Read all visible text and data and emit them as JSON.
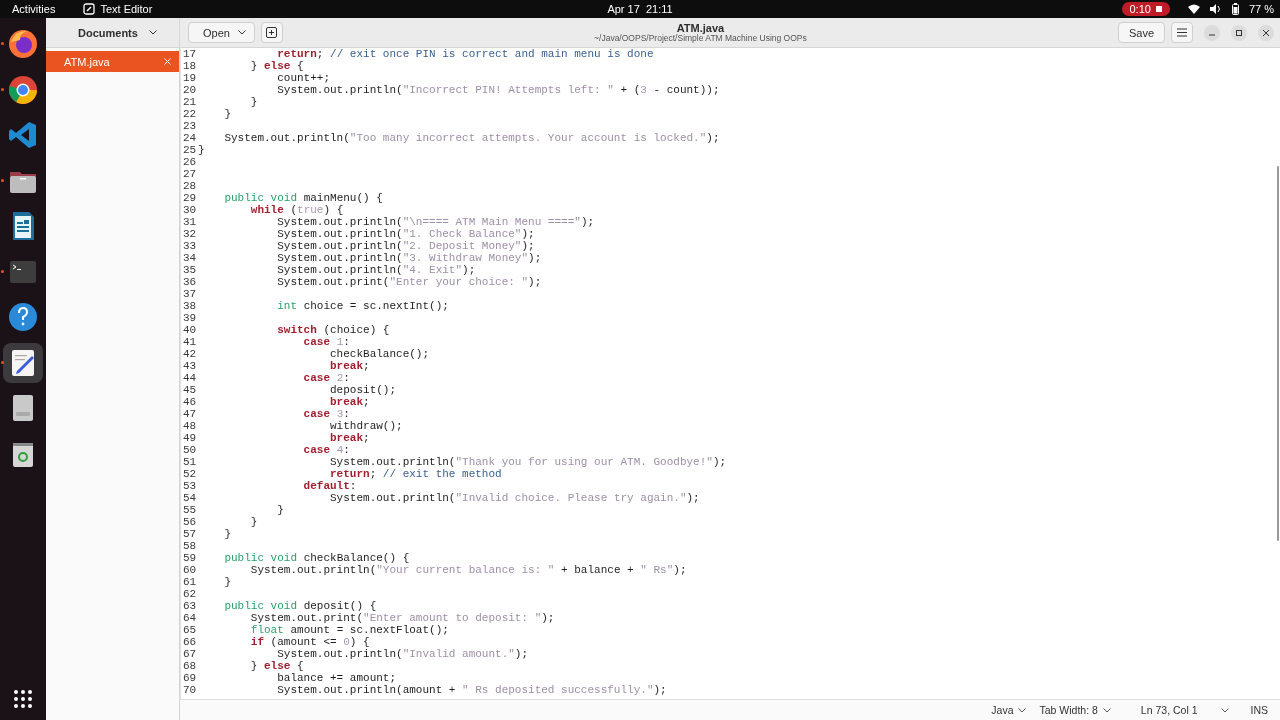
{
  "top_bar": {
    "activities": "Activities",
    "app_name": "Text Editor",
    "clock": "Apr 17  21:11",
    "recording_time": "0:10",
    "battery": "77 %"
  },
  "dock": [
    {
      "kind": "firefox",
      "running": true,
      "selected": false
    },
    {
      "kind": "chrome",
      "running": true,
      "selected": false
    },
    {
      "kind": "vscode",
      "running": false,
      "selected": false
    },
    {
      "kind": "files",
      "running": true,
      "selected": false
    },
    {
      "kind": "writer",
      "running": false,
      "selected": false
    },
    {
      "kind": "terminal",
      "running": true,
      "selected": false
    },
    {
      "kind": "help",
      "running": false,
      "selected": false
    },
    {
      "kind": "editor",
      "running": true,
      "selected": true
    },
    {
      "kind": "drive",
      "running": false,
      "selected": false
    },
    {
      "kind": "trash",
      "running": false,
      "selected": false
    }
  ],
  "header": {
    "sidebar_title": "Documents",
    "open_button": "Open",
    "title": "ATM.java",
    "subtitle": "~/Java/OOPS/Project/Simple ATM Machine Using OOPs",
    "save_button": "Save"
  },
  "documents": [
    {
      "name": "ATM.java",
      "selected": true
    }
  ],
  "code": [
    {
      "number": "17",
      "tokens": [
        {
          "kind": "keyword",
          "text": "            return"
        },
        {
          "kind": "plain",
          "text": "; "
        },
        {
          "kind": "comment",
          "text": "// exit once PIN is correct and main menu is done"
        }
      ]
    },
    {
      "number": "18",
      "tokens": [
        {
          "kind": "plain",
          "text": "        } "
        },
        {
          "kind": "keyword",
          "text": "else"
        },
        {
          "kind": "plain",
          "text": " {"
        }
      ]
    },
    {
      "number": "19",
      "tokens": [
        {
          "kind": "plain",
          "text": "            count++;"
        }
      ]
    },
    {
      "number": "20",
      "tokens": [
        {
          "kind": "plain",
          "text": "            System.out.println("
        },
        {
          "kind": "string",
          "text": "\"Incorrect PIN! Attempts left: \""
        },
        {
          "kind": "plain",
          "text": " + ("
        },
        {
          "kind": "number",
          "text": "3"
        },
        {
          "kind": "plain",
          "text": " - count));"
        }
      ]
    },
    {
      "number": "21",
      "tokens": [
        {
          "kind": "plain",
          "text": "        }"
        }
      ]
    },
    {
      "number": "22",
      "tokens": [
        {
          "kind": "plain",
          "text": "    }"
        }
      ]
    },
    {
      "number": "23"
    },
    {
      "number": "24",
      "tokens": [
        {
          "kind": "plain",
          "text": "    System.out.println("
        },
        {
          "kind": "string",
          "text": "\"Too many incorrect attempts. Your account is locked.\""
        },
        {
          "kind": "plain",
          "text": ");"
        }
      ]
    },
    {
      "number": "25",
      "tokens": [
        {
          "kind": "plain",
          "text": "}"
        }
      ]
    },
    {
      "number": "26"
    },
    {
      "number": "27"
    },
    {
      "number": "28"
    },
    {
      "number": "29",
      "tokens": [
        {
          "kind": "type",
          "text": "    public"
        },
        {
          "kind": "type",
          "text": " void"
        },
        {
          "kind": "plain",
          "text": " mainMenu() {"
        }
      ]
    },
    {
      "number": "30",
      "tokens": [
        {
          "kind": "keyword",
          "text": "        while"
        },
        {
          "kind": "plain",
          "text": " ("
        },
        {
          "kind": "number",
          "text": "true"
        },
        {
          "kind": "plain",
          "text": ") {"
        }
      ]
    },
    {
      "number": "31",
      "tokens": [
        {
          "kind": "plain",
          "text": "            System.out.println("
        },
        {
          "kind": "string",
          "text": "\"\\n==== ATM Main Menu ====\""
        },
        {
          "kind": "plain",
          "text": ");"
        }
      ]
    },
    {
      "number": "32",
      "tokens": [
        {
          "kind": "plain",
          "text": "            System.out.println("
        },
        {
          "kind": "string",
          "text": "\"1. Check Balance\""
        },
        {
          "kind": "plain",
          "text": ");"
        }
      ]
    },
    {
      "number": "33",
      "tokens": [
        {
          "kind": "plain",
          "text": "            System.out.println("
        },
        {
          "kind": "string",
          "text": "\"2. Deposit Money\""
        },
        {
          "kind": "plain",
          "text": ");"
        }
      ]
    },
    {
      "number": "34",
      "tokens": [
        {
          "kind": "plain",
          "text": "            System.out.println("
        },
        {
          "kind": "string",
          "text": "\"3. Withdraw Money\""
        },
        {
          "kind": "plain",
          "text": ");"
        }
      ]
    },
    {
      "number": "35",
      "tokens": [
        {
          "kind": "plain",
          "text": "            System.out.println("
        },
        {
          "kind": "string",
          "text": "\"4. Exit\""
        },
        {
          "kind": "plain",
          "text": ");"
        }
      ]
    },
    {
      "number": "36",
      "tokens": [
        {
          "kind": "plain",
          "text": "            System.out.print("
        },
        {
          "kind": "string",
          "text": "\"Enter your choice: \""
        },
        {
          "kind": "plain",
          "text": ");"
        }
      ]
    },
    {
      "number": "37"
    },
    {
      "number": "38",
      "tokens": [
        {
          "kind": "type",
          "text": "            int"
        },
        {
          "kind": "plain",
          "text": " choice = sc.nextInt();"
        }
      ]
    },
    {
      "number": "39"
    },
    {
      "number": "40",
      "tokens": [
        {
          "kind": "keyword",
          "text": "            switch"
        },
        {
          "kind": "plain",
          "text": " (choice) {"
        }
      ]
    },
    {
      "number": "41",
      "tokens": [
        {
          "kind": "keyword",
          "text": "                case"
        },
        {
          "kind": "number",
          "text": " 1"
        },
        {
          "kind": "plain",
          "text": ":"
        }
      ]
    },
    {
      "number": "42",
      "tokens": [
        {
          "kind": "plain",
          "text": "                    checkBalance();"
        }
      ]
    },
    {
      "number": "43",
      "tokens": [
        {
          "kind": "keyword",
          "text": "                    break"
        },
        {
          "kind": "plain",
          "text": ";"
        }
      ]
    },
    {
      "number": "44",
      "tokens": [
        {
          "kind": "keyword",
          "text": "                case"
        },
        {
          "kind": "number",
          "text": " 2"
        },
        {
          "kind": "plain",
          "text": ":"
        }
      ]
    },
    {
      "number": "45",
      "tokens": [
        {
          "kind": "plain",
          "text": "                    deposit();"
        }
      ]
    },
    {
      "number": "46",
      "tokens": [
        {
          "kind": "keyword",
          "text": "                    break"
        },
        {
          "kind": "plain",
          "text": ";"
        }
      ]
    },
    {
      "number": "47",
      "tokens": [
        {
          "kind": "keyword",
          "text": "                case"
        },
        {
          "kind": "number",
          "text": " 3"
        },
        {
          "kind": "plain",
          "text": ":"
        }
      ]
    },
    {
      "number": "48",
      "tokens": [
        {
          "kind": "plain",
          "text": "                    withdraw();"
        }
      ]
    },
    {
      "number": "49",
      "tokens": [
        {
          "kind": "keyword",
          "text": "                    break"
        },
        {
          "kind": "plain",
          "text": ";"
        }
      ]
    },
    {
      "number": "50",
      "tokens": [
        {
          "kind": "keyword",
          "text": "                case"
        },
        {
          "kind": "number",
          "text": " 4"
        },
        {
          "kind": "plain",
          "text": ":"
        }
      ]
    },
    {
      "number": "51",
      "tokens": [
        {
          "kind": "plain",
          "text": "                    System.out.println("
        },
        {
          "kind": "string",
          "text": "\"Thank you for using our ATM. Goodbye!\""
        },
        {
          "kind": "plain",
          "text": ");"
        }
      ]
    },
    {
      "number": "52",
      "tokens": [
        {
          "kind": "keyword",
          "text": "                    return"
        },
        {
          "kind": "plain",
          "text": "; "
        },
        {
          "kind": "comment",
          "text": "// exit the method"
        }
      ]
    },
    {
      "number": "53",
      "tokens": [
        {
          "kind": "keyword",
          "text": "                default"
        },
        {
          "kind": "plain",
          "text": ":"
        }
      ]
    },
    {
      "number": "54",
      "tokens": [
        {
          "kind": "plain",
          "text": "                    System.out.println("
        },
        {
          "kind": "string",
          "text": "\"Invalid choice. Please try again.\""
        },
        {
          "kind": "plain",
          "text": ");"
        }
      ]
    },
    {
      "number": "55",
      "tokens": [
        {
          "kind": "plain",
          "text": "            }"
        }
      ]
    },
    {
      "number": "56",
      "tokens": [
        {
          "kind": "plain",
          "text": "        }"
        }
      ]
    },
    {
      "number": "57",
      "tokens": [
        {
          "kind": "plain",
          "text": "    }"
        }
      ]
    },
    {
      "number": "58"
    },
    {
      "number": "59",
      "tokens": [
        {
          "kind": "type",
          "text": "    public"
        },
        {
          "kind": "type",
          "text": " void"
        },
        {
          "kind": "plain",
          "text": " checkBalance() {"
        }
      ]
    },
    {
      "number": "60",
      "tokens": [
        {
          "kind": "plain",
          "text": "        System.out.println("
        },
        {
          "kind": "string",
          "text": "\"Your current balance is: \""
        },
        {
          "kind": "plain",
          "text": " + balance + "
        },
        {
          "kind": "string",
          "text": "\" Rs\""
        },
        {
          "kind": "plain",
          "text": ");"
        }
      ]
    },
    {
      "number": "61",
      "tokens": [
        {
          "kind": "plain",
          "text": "    }"
        }
      ]
    },
    {
      "number": "62"
    },
    {
      "number": "63",
      "tokens": [
        {
          "kind": "type",
          "text": "    public"
        },
        {
          "kind": "type",
          "text": " void"
        },
        {
          "kind": "plain",
          "text": " deposit() {"
        }
      ]
    },
    {
      "number": "64",
      "tokens": [
        {
          "kind": "plain",
          "text": "        System.out.print("
        },
        {
          "kind": "string",
          "text": "\"Enter amount to deposit: \""
        },
        {
          "kind": "plain",
          "text": ");"
        }
      ]
    },
    {
      "number": "65",
      "tokens": [
        {
          "kind": "type",
          "text": "        float"
        },
        {
          "kind": "plain",
          "text": " amount = sc.nextFloat();"
        }
      ]
    },
    {
      "number": "66",
      "tokens": [
        {
          "kind": "keyword",
          "text": "        if"
        },
        {
          "kind": "plain",
          "text": " (amount <= "
        },
        {
          "kind": "number",
          "text": "0"
        },
        {
          "kind": "plain",
          "text": ") {"
        }
      ]
    },
    {
      "number": "67",
      "tokens": [
        {
          "kind": "plain",
          "text": "            System.out.println("
        },
        {
          "kind": "string",
          "text": "\"Invalid amount.\""
        },
        {
          "kind": "plain",
          "text": ");"
        }
      ]
    },
    {
      "number": "68",
      "tokens": [
        {
          "kind": "plain",
          "text": "        } "
        },
        {
          "kind": "keyword",
          "text": "else"
        },
        {
          "kind": "plain",
          "text": " {"
        }
      ]
    },
    {
      "number": "69",
      "tokens": [
        {
          "kind": "plain",
          "text": "            balance += amount;"
        }
      ]
    },
    {
      "number": "70",
      "tokens": [
        {
          "kind": "plain",
          "text": "            System.out.println(amount + "
        },
        {
          "kind": "string",
          "text": "\" Rs deposited successfully.\""
        },
        {
          "kind": "plain",
          "text": ");"
        }
      ]
    }
  ],
  "status_bar": {
    "language": "Java",
    "tab_width": "Tab Width: 8",
    "position": "Ln 73, Col 1",
    "mode": "INS"
  }
}
